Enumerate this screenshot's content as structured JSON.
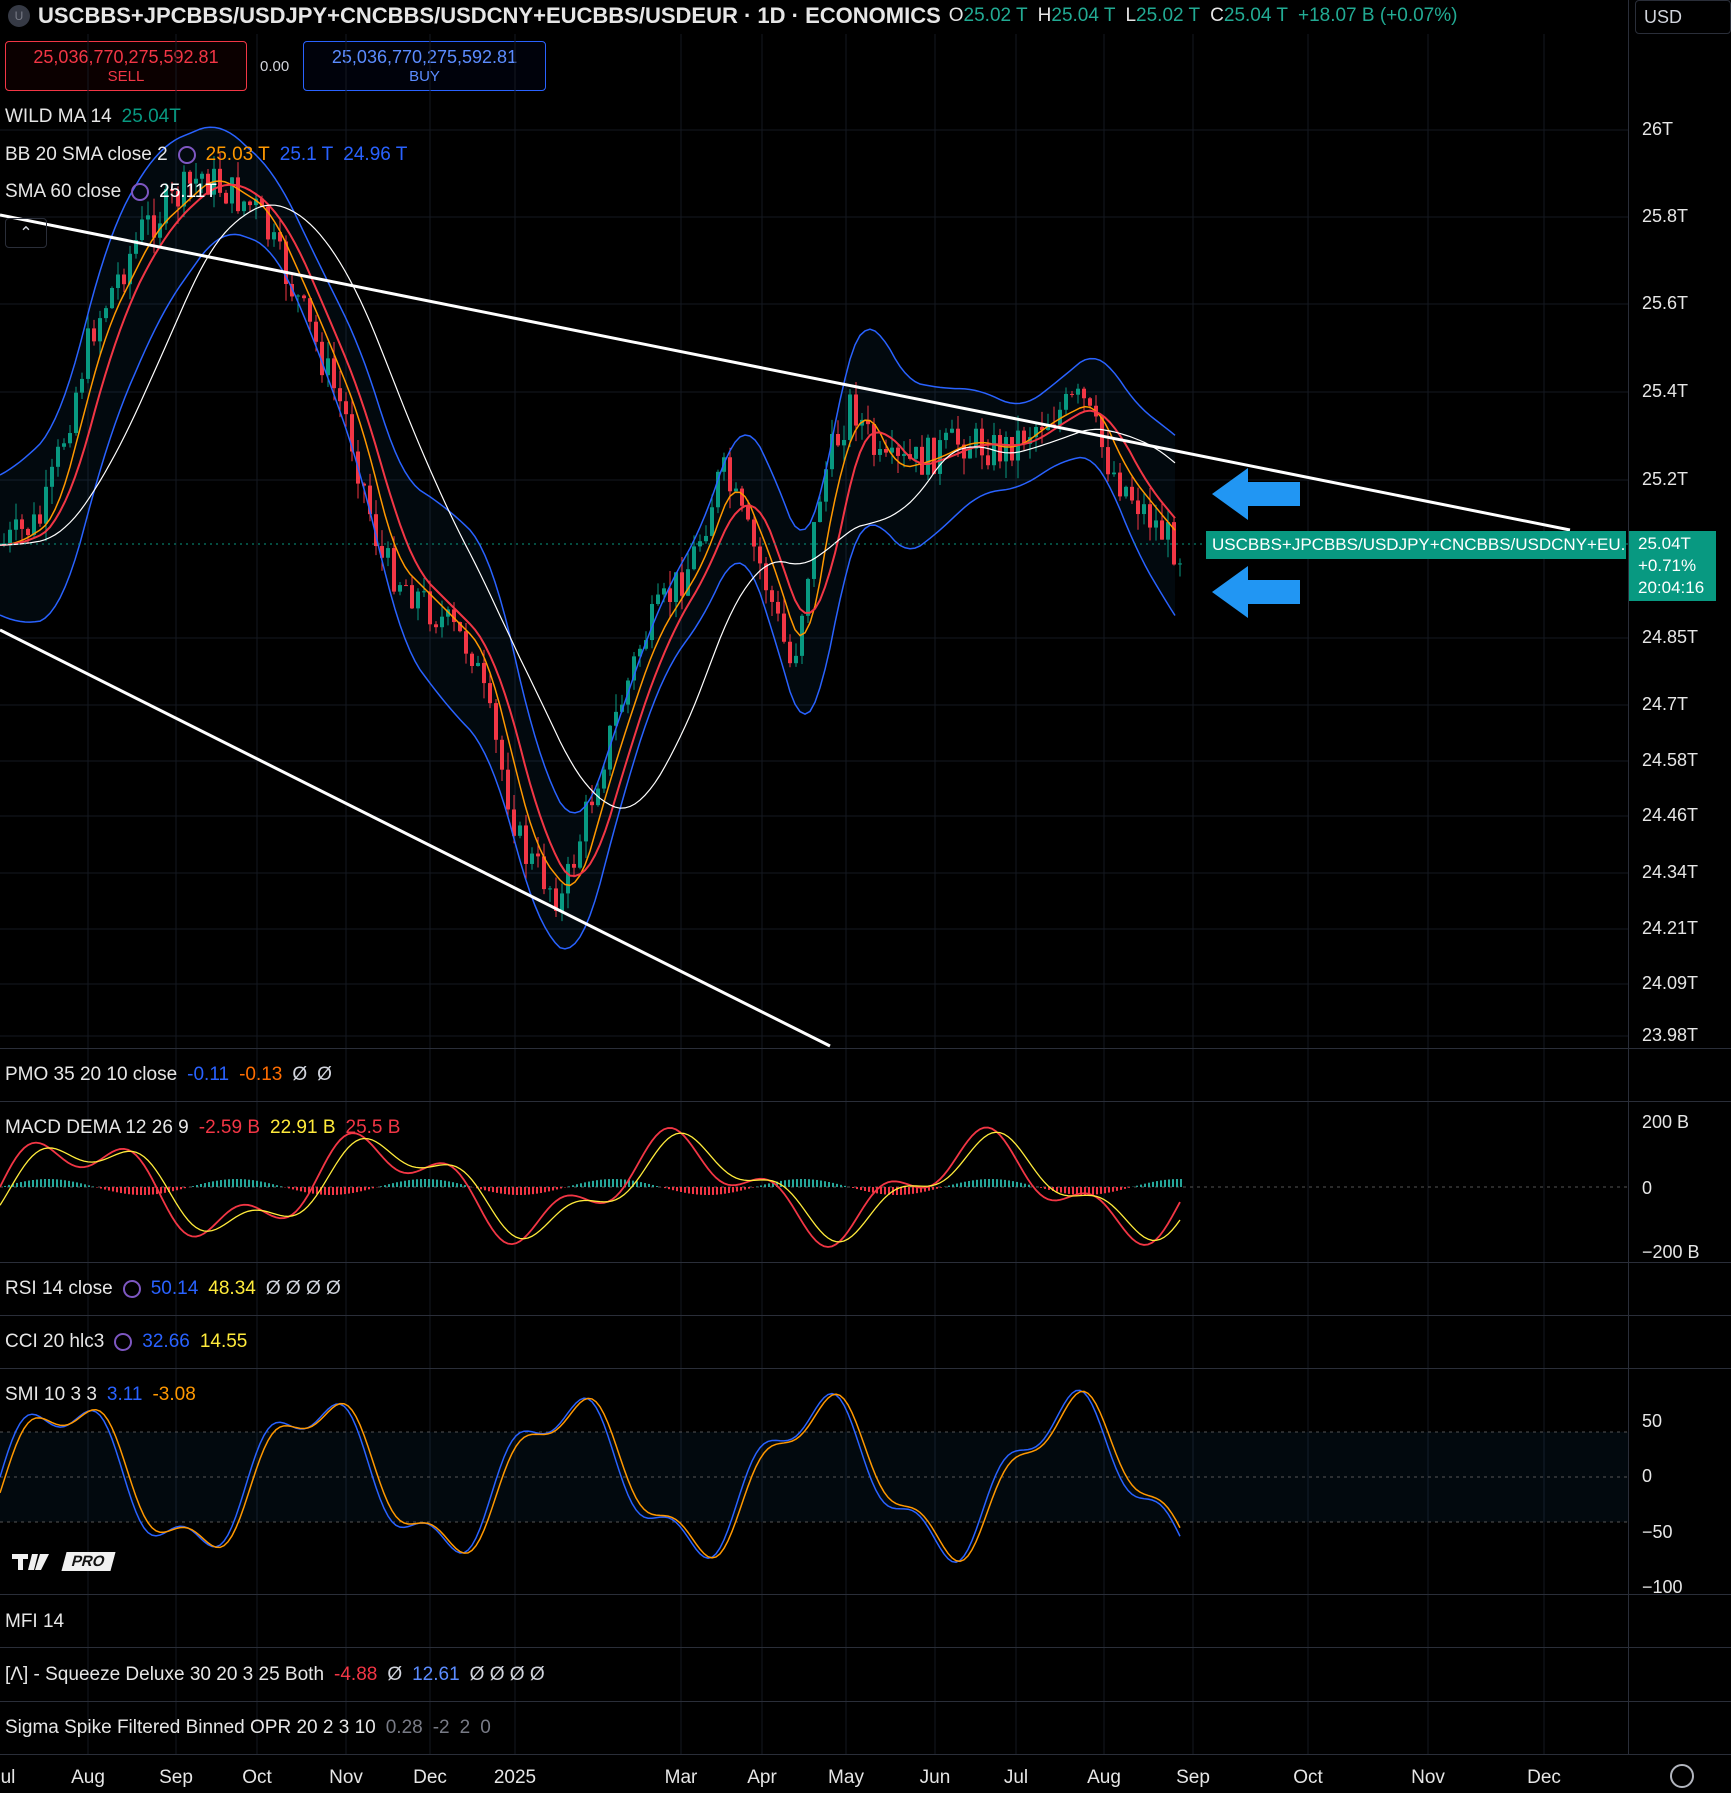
{
  "header": {
    "symbol_badge": "U",
    "title": "USCBBS+JPCBBS/USDJPY+CNCBBS/USDCNY+EUCBBS/USDEUR · 1D · ECONOMICS",
    "ohlc": [
      {
        "k": "O",
        "v": "25.02 T"
      },
      {
        "k": "H",
        "v": "25.04 T"
      },
      {
        "k": "L",
        "v": "25.02 T"
      },
      {
        "k": "C",
        "v": "25.04 T"
      }
    ],
    "change": "+18.07 B (+0.07%)",
    "currency": "USD"
  },
  "trade": {
    "sell_price": "25,036,770,275,592.81",
    "sell_label": "SELL",
    "spread": "0.00",
    "buy_price": "25,036,770,275,592.81",
    "buy_label": "BUY"
  },
  "indicators": {
    "wild_ma": {
      "name": "WILD MA 14",
      "v1": "25.04T"
    },
    "bb": {
      "name": "BB 20 SMA close 2",
      "v1": "25.03 T",
      "v2": "25.1 T",
      "v3": "24.96 T"
    },
    "sma": {
      "name": "SMA 60 close",
      "v1": "25.11T"
    }
  },
  "price_axis": [
    "26T",
    "25.8T",
    "25.6T",
    "25.4T",
    "25.2T",
    "24.85T",
    "24.7T",
    "24.58T",
    "24.46T",
    "24.34T",
    "24.21T",
    "24.09T",
    "23.98T"
  ],
  "last_price": {
    "tag": "USCBBS+JPCBBS/USDJPY+CNCBBS/USDCNY+EU...",
    "price": "25.04T",
    "pct": "+0.71%",
    "countdown": "20:04:16"
  },
  "panes": {
    "pmo": {
      "name": "PMO 35 20 10 close",
      "v1": "-0.11",
      "v2": "-0.13",
      "v3": "Ø",
      "v4": "Ø"
    },
    "macd": {
      "name": "MACD DEMA 12 26 9",
      "v1": "-2.59 B",
      "v2": "22.91 B",
      "v3": "25.5 B",
      "axis": [
        "200 B",
        "0",
        "−200 B"
      ]
    },
    "rsi": {
      "name": "RSI 14 close",
      "v1": "50.14",
      "v2": "48.34",
      "v3": "Ø Ø Ø Ø"
    },
    "cci": {
      "name": "CCI 20 hlc3",
      "v1": "32.66",
      "v2": "14.55"
    },
    "smi": {
      "name": "SMI 10 3 3",
      "v1": "3.11",
      "v2": "-3.08",
      "axis": [
        "50",
        "0",
        "−50",
        "−100"
      ]
    },
    "mfi": {
      "name": "MFI 14"
    },
    "squeeze": {
      "name": "[Λ] - Squeeze Deluxe 30 20 3 25 Both",
      "v1": "-4.88",
      "v2": "Ø",
      "v3": "12.61",
      "v4": "Ø Ø Ø Ø"
    },
    "sigma": {
      "name": "Sigma Spike Filtered Binned OPR 20 2 3 10",
      "v1": "0.28",
      "v2": "-2",
      "v3": "2",
      "v4": "0"
    }
  },
  "time_axis": [
    "ul",
    "Aug",
    "Sep",
    "Oct",
    "Nov",
    "Dec",
    "2025",
    "Mar",
    "Apr",
    "May",
    "Jun",
    "Jul",
    "Aug",
    "Sep",
    "Oct",
    "Nov",
    "Dec"
  ],
  "logo": {
    "pro": "PRO"
  },
  "colors": {
    "up": "#089981",
    "down": "#f23645",
    "bb": "#2962ff",
    "wild": "#ff9800",
    "sma": "#ffffff",
    "accent_arrow": "#2196f3"
  }
}
